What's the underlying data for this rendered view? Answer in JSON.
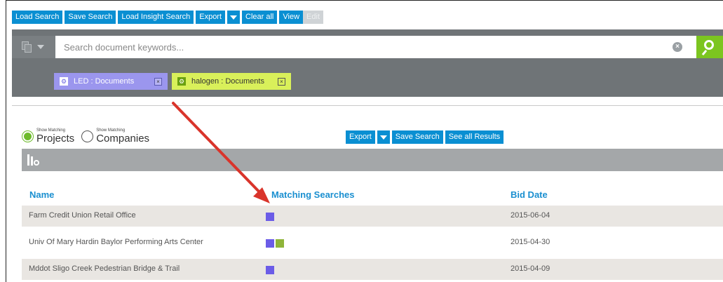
{
  "toolbar": {
    "load_search": "Load Search",
    "save_search": "Save Search",
    "load_insight_search": "Load Insight Search",
    "export": "Export",
    "clear_all": "Clear all",
    "view": "View",
    "edit": "Edit"
  },
  "search": {
    "placeholder": "Search document keywords...",
    "chips": [
      {
        "label": "LED : Documents",
        "color": "#9b96ee"
      },
      {
        "label": "halogen : Documents",
        "color": "#d9f05a"
      }
    ]
  },
  "filters": {
    "projects_small": "Show Matching",
    "projects_big": "Projects",
    "companies_small": "Show Matching",
    "companies_big": "Companies",
    "selected": "Projects"
  },
  "results_toolbar": {
    "export": "Export",
    "save_search": "Save Search",
    "see_all": "See all Results"
  },
  "table": {
    "headers": {
      "name": "Name",
      "matching": "Matching Searches",
      "bid_date": "Bid Date"
    },
    "rows": [
      {
        "name": "Farm Credit Union Retail Office",
        "matches": [
          "#6b5ce7"
        ],
        "bid_date": "2015-06-04"
      },
      {
        "name": "Univ Of Mary Hardin Baylor Performing Arts Center",
        "matches": [
          "#6b5ce7",
          "#8fb43a"
        ],
        "bid_date": "2015-04-30"
      },
      {
        "name": "Mddot Sligo Creek Pedestrian Bridge & Trail",
        "matches": [
          "#6b5ce7"
        ],
        "bid_date": "2015-04-09"
      }
    ]
  },
  "colors": {
    "accent_blue": "#0a8fd2",
    "search_go": "#7cc520",
    "annotation_arrow": "#d9342b"
  }
}
